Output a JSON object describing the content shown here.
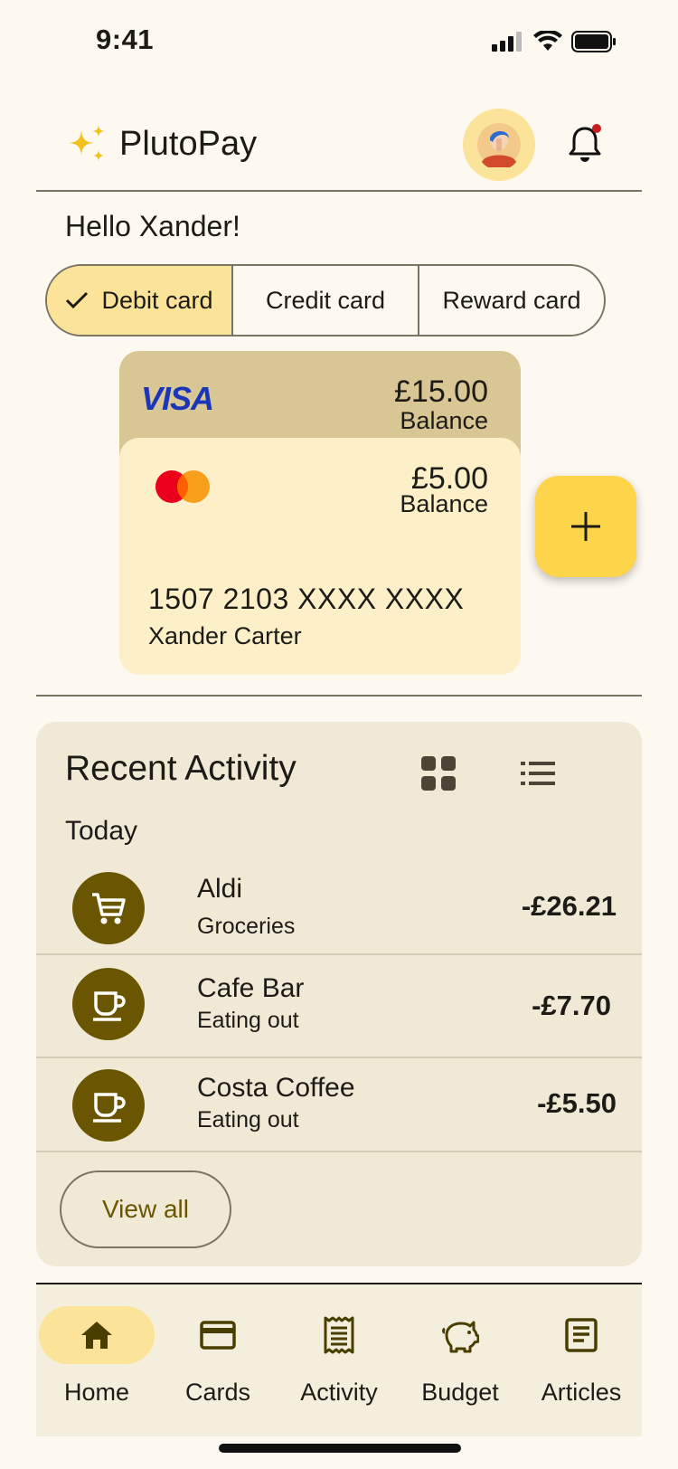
{
  "status_bar": {
    "time": "9:41"
  },
  "header": {
    "app_name": "PlutoPay",
    "notification_dot": true
  },
  "greeting": "Hello Xander!",
  "card_tabs": [
    {
      "label": "Debit card",
      "selected": true
    },
    {
      "label": "Credit card",
      "selected": false
    },
    {
      "label": "Reward card",
      "selected": false
    }
  ],
  "cards": {
    "back": {
      "brand": "VISA",
      "amount": "£15.00",
      "label": "Balance"
    },
    "front": {
      "brand": "mastercard",
      "amount": "£5.00",
      "label": "Balance",
      "number": "1507 2103 XXXX XXXX",
      "holder": "Xander Carter"
    }
  },
  "activity": {
    "title": "Recent Activity",
    "section": "Today",
    "transactions": [
      {
        "name": "Aldi",
        "category": "Groceries",
        "amount": "-£26.21",
        "icon": "cart-icon"
      },
      {
        "name": "Cafe Bar",
        "category": "Eating out",
        "amount": "-£7.70",
        "icon": "coffee-icon"
      },
      {
        "name": "Costa Coffee",
        "category": "Eating out",
        "amount": "-£5.50",
        "icon": "coffee-icon"
      }
    ],
    "view_all": "View all"
  },
  "nav": [
    {
      "label": "Home",
      "icon": "home-icon",
      "active": true
    },
    {
      "label": "Cards",
      "icon": "card-icon",
      "active": false
    },
    {
      "label": "Activity",
      "icon": "receipt-icon",
      "active": false
    },
    {
      "label": "Budget",
      "icon": "piggy-bank-icon",
      "active": false
    },
    {
      "label": "Articles",
      "icon": "article-icon",
      "active": false
    }
  ],
  "colors": {
    "background": "#fdf8f0",
    "accent": "#fed44a",
    "selected": "#fce39a",
    "icon_circle": "#6a5600",
    "visa_blue": "#1a35b8"
  }
}
